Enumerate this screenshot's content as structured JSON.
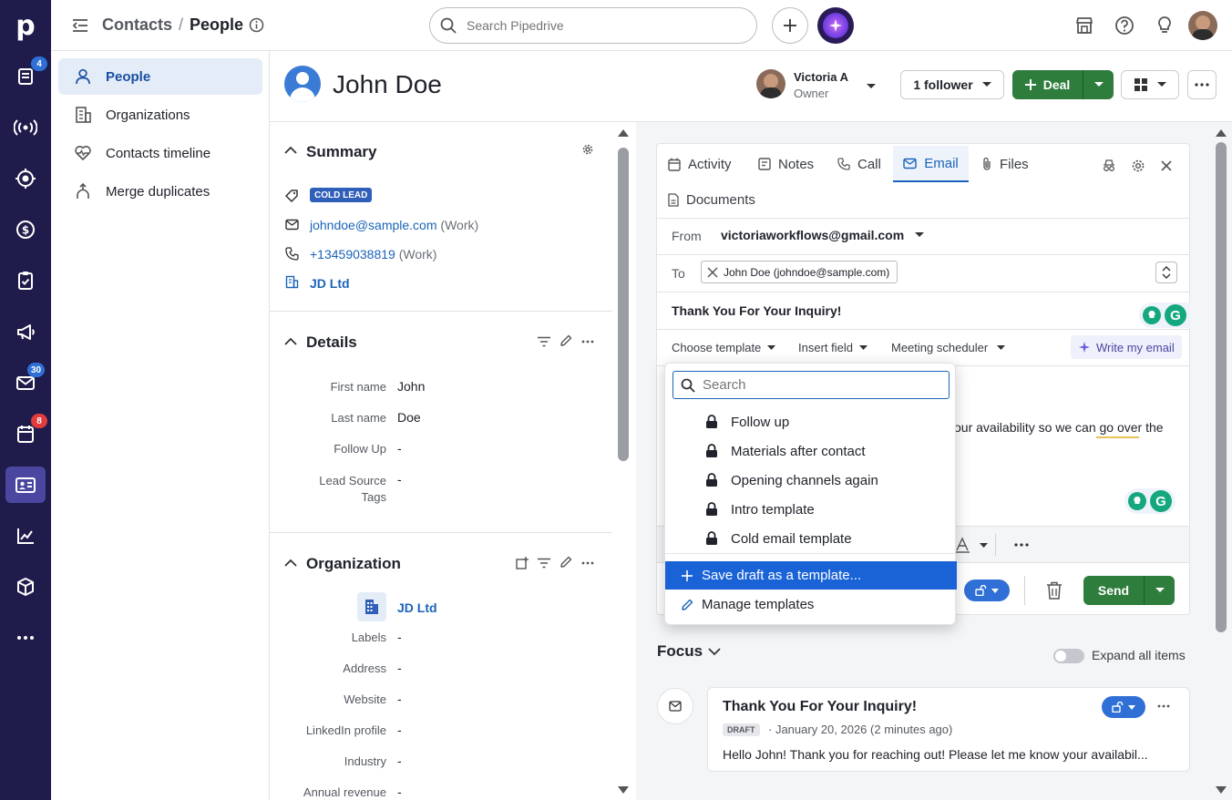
{
  "brand": {
    "logo": "p",
    "colors": {
      "rail_bg": "#1f1b4a",
      "accent_blue": "#1a63b8",
      "green": "#2e7d3c",
      "badge_blue": "#2f6fd6",
      "badge_red": "#e23b3b"
    }
  },
  "rail": {
    "items": [
      {
        "icon": "leads-icon",
        "badge": "4"
      },
      {
        "icon": "campaigns-radio-icon",
        "badge": ""
      },
      {
        "icon": "target-icon",
        "badge": ""
      },
      {
        "icon": "deals-dollar-icon",
        "badge": ""
      },
      {
        "icon": "tasks-clipboard-icon",
        "badge": ""
      },
      {
        "icon": "megaphone-icon",
        "badge": ""
      },
      {
        "icon": "mail-icon",
        "badge": "30"
      },
      {
        "icon": "calendar-icon",
        "badge": "8"
      },
      {
        "icon": "contacts-card-icon",
        "badge": ""
      },
      {
        "icon": "insights-chart-icon",
        "badge": ""
      },
      {
        "icon": "products-box-icon",
        "badge": ""
      },
      {
        "icon": "more-icon",
        "badge": ""
      }
    ]
  },
  "topbar": {
    "breadcrumb_parent": "Contacts",
    "breadcrumb_sep": "/",
    "breadcrumb_current": "People",
    "search_placeholder": "Search Pipedrive"
  },
  "nav": {
    "items": [
      {
        "label": "People",
        "icon": "person-icon",
        "active": true
      },
      {
        "label": "Organizations",
        "icon": "building-icon",
        "active": false
      },
      {
        "label": "Contacts timeline",
        "icon": "heart-pulse-icon",
        "active": false
      },
      {
        "label": "Merge duplicates",
        "icon": "merge-icon",
        "active": false
      }
    ]
  },
  "header": {
    "person_name": "John Doe",
    "owner_name": "Victoria A",
    "owner_role": "Owner",
    "follower_label": "1 follower",
    "deal_label": "Deal"
  },
  "summary": {
    "title": "Summary",
    "tag": "COLD LEAD",
    "email": "johndoe@sample.com",
    "email_type": "(Work)",
    "phone": "+13459038819",
    "phone_type": "(Work)",
    "org": "JD Ltd"
  },
  "details": {
    "title": "Details",
    "fields": [
      {
        "label": "First name",
        "value": "John"
      },
      {
        "label": "Last name",
        "value": "Doe"
      },
      {
        "label": "Follow Up",
        "value": "-"
      },
      {
        "label": "Lead Source\nTags",
        "value": "-"
      }
    ]
  },
  "organization": {
    "title": "Organization",
    "name": "JD Ltd",
    "fields": [
      {
        "label": "Labels",
        "value": "-"
      },
      {
        "label": "Address",
        "value": "-"
      },
      {
        "label": "Website",
        "value": "-"
      },
      {
        "label": "LinkedIn profile",
        "value": "-"
      },
      {
        "label": "Industry",
        "value": "-"
      },
      {
        "label": "Annual revenue",
        "value": "-"
      }
    ]
  },
  "composer": {
    "tabs": [
      {
        "label": "Activity",
        "icon": "calendar-icon"
      },
      {
        "label": "Notes",
        "icon": "note-icon"
      },
      {
        "label": "Call",
        "icon": "phone-icon"
      },
      {
        "label": "Email",
        "icon": "mail-icon",
        "active": true
      },
      {
        "label": "Files",
        "icon": "paperclip-icon"
      },
      {
        "label": "Documents",
        "icon": "document-icon"
      }
    ],
    "from_label": "From",
    "from_value": "victoriaworkflows@gmail.com",
    "to_label": "To",
    "to_chip": "John Doe (johndoe@sample.com)",
    "subject": "Thank You For Your Inquiry!",
    "toolbar": {
      "choose_template": "Choose template",
      "insert_field": "Insert field",
      "meeting_scheduler": "Meeting scheduler",
      "write_my_email": "Write my email"
    },
    "body_fragment": "our availability so we can go over the",
    "send_label": "Send"
  },
  "template_dropdown": {
    "search_placeholder": "Search",
    "templates": [
      "Follow up",
      "Materials after contact",
      "Opening channels again",
      "Intro template",
      "Cold email template"
    ],
    "save_draft": "Save draft as a template...",
    "manage": "Manage templates"
  },
  "focus": {
    "title": "Focus",
    "expand_label": "Expand all items",
    "card_title": "Thank You For Your Inquiry!",
    "card_badge": "DRAFT",
    "card_meta": "· January 20, 2026 (2 minutes ago)",
    "card_preview": "Hello John! Thank you for reaching out! Please let me know your availabil..."
  }
}
